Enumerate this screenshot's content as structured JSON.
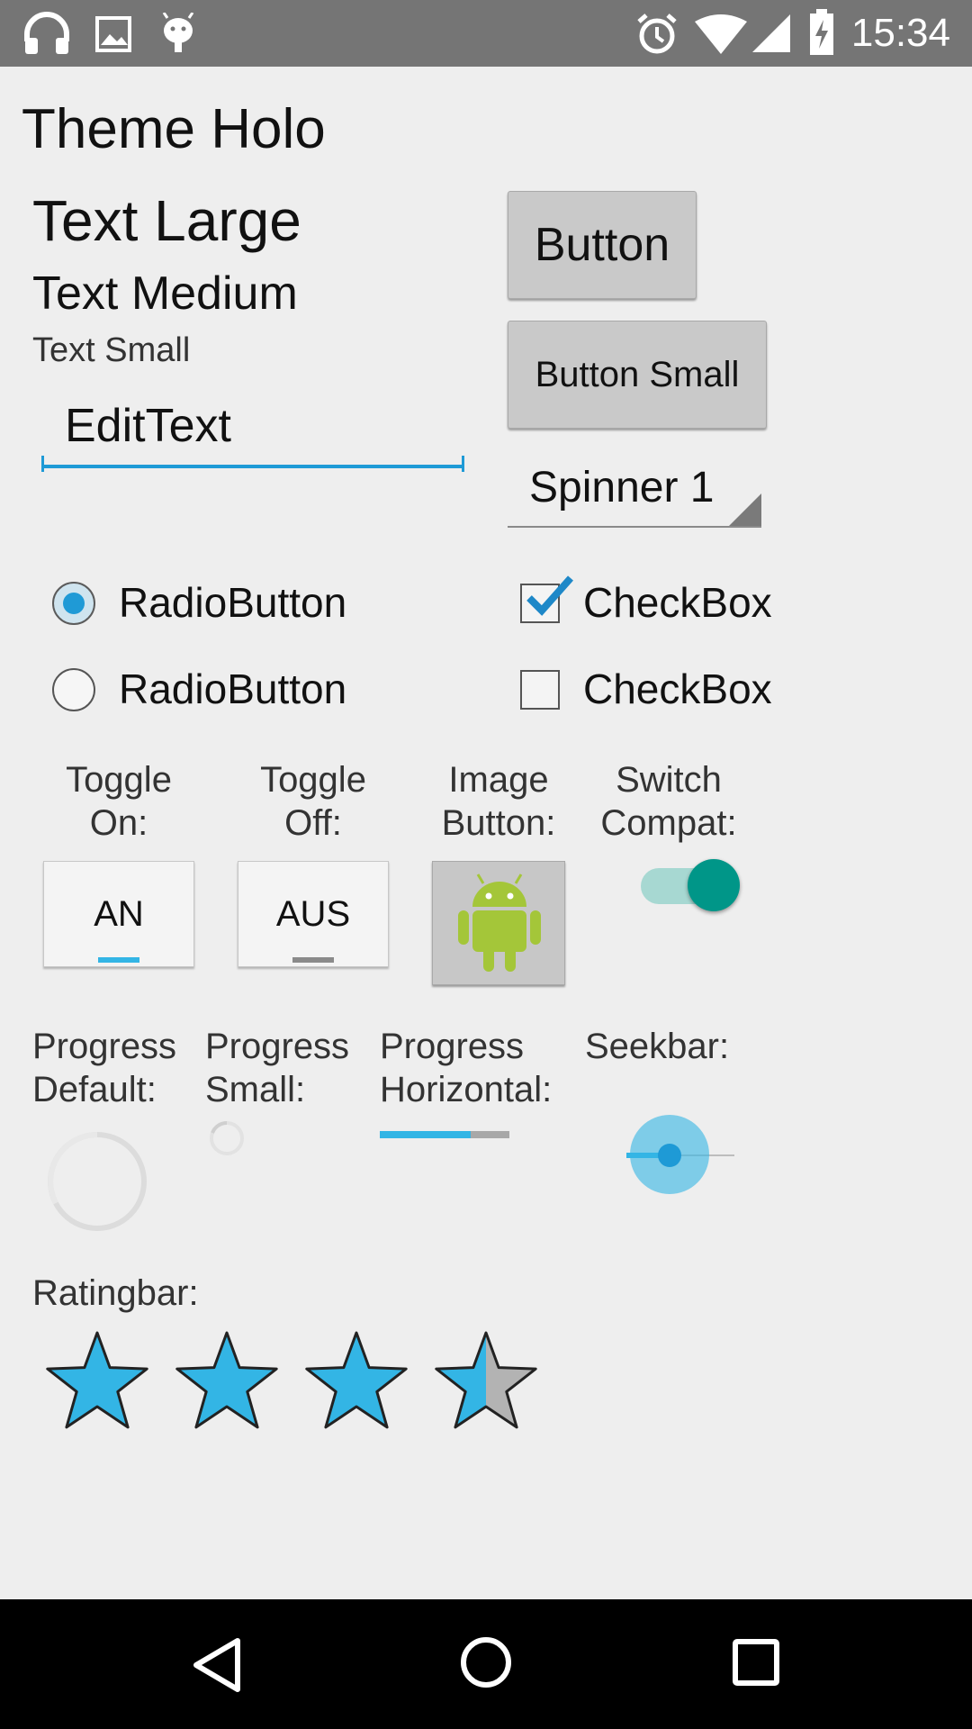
{
  "status_bar": {
    "time": "15:34",
    "left_icons": [
      "headphones-icon",
      "image-icon",
      "android-debug-icon"
    ],
    "right_icons": [
      "alarm-icon",
      "wifi-icon",
      "signal-icon",
      "battery-charging-icon"
    ]
  },
  "page": {
    "title": "Theme Holo"
  },
  "text": {
    "large": "Text Large",
    "medium": "Text Medium",
    "small": "Text Small"
  },
  "buttons": {
    "button_label": "Button",
    "button_small_label": "Button Small"
  },
  "edittext": {
    "value": "EditText"
  },
  "spinner": {
    "selected": "Spinner 1"
  },
  "radios": [
    {
      "label": "RadioButton",
      "checked": true
    },
    {
      "label": "RadioButton",
      "checked": false
    }
  ],
  "checkboxes": [
    {
      "label": "CheckBox",
      "checked": true
    },
    {
      "label": "CheckBox",
      "checked": false
    }
  ],
  "toggles": {
    "on_caption_1": "Toggle",
    "on_caption_2": "On:",
    "on_label": "AN",
    "off_caption_1": "Toggle",
    "off_caption_2": "Off:",
    "off_label": "AUS"
  },
  "image_button": {
    "caption_1": "Image",
    "caption_2": "Button:",
    "icon": "android-robot-icon"
  },
  "switch_compat": {
    "caption_1": "Switch",
    "caption_2": "Compat:",
    "checked": true
  },
  "progress": {
    "default_caption_1": "Progress",
    "default_caption_2": "Default:",
    "small_caption_1": "Progress",
    "small_caption_2": "Small:",
    "horizontal_caption_1": "Progress",
    "horizontal_caption_2": "Horizontal:",
    "horizontal_fraction": 0.7
  },
  "seekbar": {
    "caption": "Seekbar:",
    "fraction": 0.4
  },
  "ratingbar": {
    "caption": "Ratingbar:",
    "num_stars": 4,
    "rating": 3.5
  },
  "colors": {
    "accent_blue": "#33b5e5",
    "edit_underline": "#1e9ad6",
    "switch_thumb": "#009688",
    "status_bar": "#757575",
    "nav_bar": "#000000",
    "android_green": "#a4c639"
  },
  "nav_bar": {
    "icons": [
      "back-icon",
      "home-icon",
      "recents-icon"
    ]
  }
}
